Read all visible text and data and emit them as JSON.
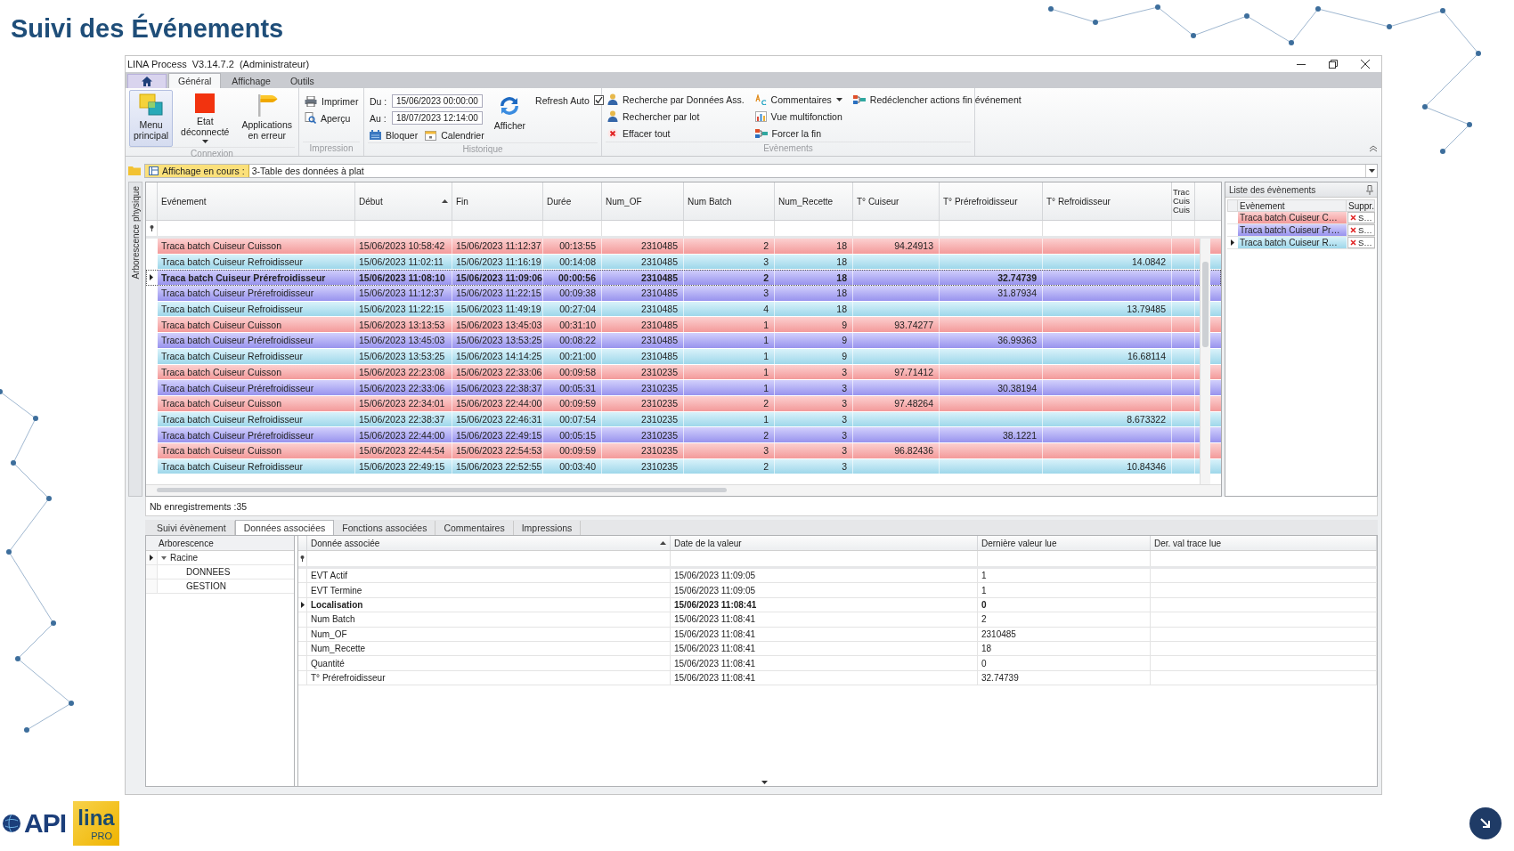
{
  "slide_title": "Suivi des Événements",
  "window": {
    "title": "LINA Process  V3.14.7.2  (Administrateur)"
  },
  "ribbon": {
    "tabs": [
      {
        "label": "Général",
        "selected": true
      },
      {
        "label": "Affichage",
        "selected": false
      },
      {
        "label": "Outils",
        "selected": false
      }
    ],
    "connexion": {
      "group_label": "Connexion",
      "buttons": [
        {
          "label": "Menu principal",
          "selected": true
        },
        {
          "label": "Etat déconnecté",
          "selected": false,
          "dropdown": true
        },
        {
          "label": "Applications en erreur",
          "selected": false
        }
      ]
    },
    "impression": {
      "group_label": "Impression",
      "buttons": [
        {
          "label": "Imprimer"
        },
        {
          "label": "Aperçu"
        }
      ]
    },
    "historique": {
      "group_label": "Historique",
      "from_label": "Du :",
      "from_value": "15/06/2023 00:00:00",
      "to_label": "Au :",
      "to_value": "18/07/2023 12:14:00",
      "buttons": [
        {
          "label": "Bloquer"
        },
        {
          "label": "Calendrier"
        }
      ],
      "refresh_button": {
        "label": "Afficher"
      },
      "auto_refresh": {
        "label": "Refresh Auto",
        "checked": true
      }
    },
    "evenements": {
      "group_label": "Evènements",
      "buttons": [
        {
          "label": "Recherche par Données Ass."
        },
        {
          "label": "Rechercher par lot"
        },
        {
          "label": "Effacer tout"
        },
        {
          "label": "Commentaires",
          "dropdown": true
        },
        {
          "label": "Vue multifonction"
        },
        {
          "label": "Forcer la fin"
        },
        {
          "label": "Redéclencher actions fin événement"
        }
      ]
    }
  },
  "view_selector": {
    "label": "Affichage en cours :",
    "value": "3-Table des données à plat"
  },
  "side_strip": {
    "label": "Arborescence physique"
  },
  "events_table": {
    "columns": [
      {
        "label": "Evénement",
        "sorted": false
      },
      {
        "label": "Début",
        "sorted": true
      },
      {
        "label": "Fin",
        "sorted": false
      },
      {
        "label": "Durée",
        "sorted": false
      },
      {
        "label": "Num_OF",
        "sorted": false
      },
      {
        "label": "Num Batch",
        "sorted": false
      },
      {
        "label": "Num_Recette",
        "sorted": false
      },
      {
        "label": "T° Cuiseur",
        "sorted": false
      },
      {
        "label": "T° Prérefroidisseur",
        "sorted": false
      },
      {
        "label": "T° Refroidisseur",
        "sorted": false
      },
      {
        "label": "Trac Cuis Cuis"
      }
    ],
    "rows": [
      {
        "kind": "cuisson",
        "selected": false,
        "cells": [
          "Traca batch Cuiseur Cuisson",
          "15/06/2023 10:58:42",
          "15/06/2023 11:12:37",
          "00:13:55",
          "2310485",
          "2",
          "18",
          "94.24913",
          null,
          null
        ]
      },
      {
        "kind": "refroidisseur",
        "selected": false,
        "cells": [
          "Traca batch Cuiseur Refroidisseur",
          "15/06/2023 11:02:11",
          "15/06/2023 11:16:19",
          "00:14:08",
          "2310485",
          "3",
          "18",
          null,
          null,
          "14.0842"
        ]
      },
      {
        "kind": "prerefroidisseur",
        "selected": true,
        "cells": [
          "Traca batch Cuiseur Prérefroidisseur",
          "15/06/2023 11:08:10",
          "15/06/2023 11:09:06",
          "00:00:56",
          "2310485",
          "2",
          "18",
          null,
          "32.74739",
          null
        ]
      },
      {
        "kind": "prerefroidisseur",
        "selected": false,
        "cells": [
          "Traca batch Cuiseur Prérefroidisseur",
          "15/06/2023 11:12:37",
          "15/06/2023 11:22:15",
          "00:09:38",
          "2310485",
          "3",
          "18",
          null,
          "31.87934",
          null
        ]
      },
      {
        "kind": "refroidisseur",
        "selected": false,
        "cells": [
          "Traca batch Cuiseur Refroidisseur",
          "15/06/2023 11:22:15",
          "15/06/2023 11:49:19",
          "00:27:04",
          "2310485",
          "4",
          "18",
          null,
          null,
          "13.79485"
        ]
      },
      {
        "kind": "cuisson",
        "selected": false,
        "cells": [
          "Traca batch Cuiseur Cuisson",
          "15/06/2023 13:13:53",
          "15/06/2023 13:45:03",
          "00:31:10",
          "2310485",
          "1",
          "9",
          "93.74277",
          null,
          null
        ]
      },
      {
        "kind": "prerefroidisseur",
        "selected": false,
        "cells": [
          "Traca batch Cuiseur Prérefroidisseur",
          "15/06/2023 13:45:03",
          "15/06/2023 13:53:25",
          "00:08:22",
          "2310485",
          "1",
          "9",
          null,
          "36.99363",
          null
        ]
      },
      {
        "kind": "refroidisseur",
        "selected": false,
        "cells": [
          "Traca batch Cuiseur Refroidisseur",
          "15/06/2023 13:53:25",
          "15/06/2023 14:14:25",
          "00:21:00",
          "2310485",
          "1",
          "9",
          null,
          null,
          "16.68114"
        ]
      },
      {
        "kind": "cuisson",
        "selected": false,
        "cells": [
          "Traca batch Cuiseur Cuisson",
          "15/06/2023 22:23:08",
          "15/06/2023 22:33:06",
          "00:09:58",
          "2310235",
          "1",
          "3",
          "97.71412",
          null,
          null
        ]
      },
      {
        "kind": "prerefroidisseur",
        "selected": false,
        "cells": [
          "Traca batch Cuiseur Prérefroidisseur",
          "15/06/2023 22:33:06",
          "15/06/2023 22:38:37",
          "00:05:31",
          "2310235",
          "1",
          "3",
          null,
          "30.38194",
          null
        ]
      },
      {
        "kind": "cuisson",
        "selected": false,
        "cells": [
          "Traca batch Cuiseur Cuisson",
          "15/06/2023 22:34:01",
          "15/06/2023 22:44:00",
          "00:09:59",
          "2310235",
          "2",
          "3",
          "97.48264",
          null,
          null
        ]
      },
      {
        "kind": "refroidisseur",
        "selected": false,
        "cells": [
          "Traca batch Cuiseur Refroidisseur",
          "15/06/2023 22:38:37",
          "15/06/2023 22:46:31",
          "00:07:54",
          "2310235",
          "1",
          "3",
          null,
          null,
          "8.673322"
        ]
      },
      {
        "kind": "prerefroidisseur",
        "selected": false,
        "cells": [
          "Traca batch Cuiseur Prérefroidisseur",
          "15/06/2023 22:44:00",
          "15/06/2023 22:49:15",
          "00:05:15",
          "2310235",
          "2",
          "3",
          null,
          "38.1221",
          null
        ]
      },
      {
        "kind": "cuisson",
        "selected": false,
        "cells": [
          "Traca batch Cuiseur Cuisson",
          "15/06/2023 22:44:54",
          "15/06/2023 22:54:53",
          "00:09:59",
          "2310235",
          "3",
          "3",
          "96.82436",
          null,
          null
        ]
      },
      {
        "kind": "refroidisseur",
        "selected": false,
        "cells": [
          "Traca batch Cuiseur Refroidisseur",
          "15/06/2023 22:49:15",
          "15/06/2023 22:52:55",
          "00:03:40",
          "2310235",
          "2",
          "3",
          null,
          null,
          "10.84346"
        ]
      }
    ]
  },
  "event_list": {
    "title": "Liste des évènements",
    "columns": [
      {
        "label": "Evènement"
      },
      {
        "label": "Suppr."
      }
    ],
    "items": [
      {
        "kind": "cuisson",
        "selected": false,
        "label": "Traca batch Cuiseur C…",
        "action": "S…"
      },
      {
        "kind": "prerefroidisseur",
        "selected": false,
        "label": "Traca batch Cuiseur Pr…",
        "action": "S…"
      },
      {
        "kind": "refroidisseur",
        "selected": true,
        "label": "Traca batch Cuiseur R…",
        "action": "S…"
      }
    ]
  },
  "record_count": "Nb enregistrements :35",
  "detail_tabs": [
    {
      "label": "Suivi évènement",
      "selected": false
    },
    {
      "label": "Données associées",
      "selected": true
    },
    {
      "label": "Fonctions associées",
      "selected": false
    },
    {
      "label": "Commentaires",
      "selected": false
    },
    {
      "label": "Impressions",
      "selected": false
    }
  ],
  "tree": {
    "header": "Arborescence",
    "nodes": [
      {
        "label": "Racine",
        "expanded": true,
        "selected": true,
        "children": [
          {
            "label": "DONNEES",
            "selected": false
          },
          {
            "label": "GESTION",
            "selected": false
          }
        ]
      }
    ]
  },
  "details_table": {
    "columns": [
      {
        "label": "Donnée associée",
        "sorted": true
      },
      {
        "label": "Date de la valeur",
        "sorted": false
      },
      {
        "label": "Dernière valeur lue",
        "sorted": false
      },
      {
        "label": "Der. val trace lue",
        "sorted": false
      }
    ],
    "rows": [
      {
        "selected": false,
        "cells": [
          "EVT Actif",
          "15/06/2023 11:09:05",
          "1"
        ]
      },
      {
        "selected": false,
        "cells": [
          "EVT Termine",
          "15/06/2023 11:09:05",
          "1"
        ]
      },
      {
        "selected": true,
        "cells": [
          "Localisation",
          "15/06/2023 11:08:41",
          "0"
        ]
      },
      {
        "selected": false,
        "cells": [
          "Num Batch",
          "15/06/2023 11:08:41",
          "2"
        ]
      },
      {
        "selected": false,
        "cells": [
          "Num_OF",
          "15/06/2023 11:08:41",
          "2310485"
        ]
      },
      {
        "selected": false,
        "cells": [
          "Num_Recette",
          "15/06/2023 11:08:41",
          "18"
        ]
      },
      {
        "selected": false,
        "cells": [
          "Quantité",
          "15/06/2023 11:08:41",
          "0"
        ]
      },
      {
        "selected": false,
        "cells": [
          "T° Prérefroidisseur",
          "15/06/2023 11:08:41",
          "32.74739"
        ]
      }
    ]
  },
  "footer": {
    "brand": "API",
    "product": "lina",
    "edition": "PRO"
  }
}
